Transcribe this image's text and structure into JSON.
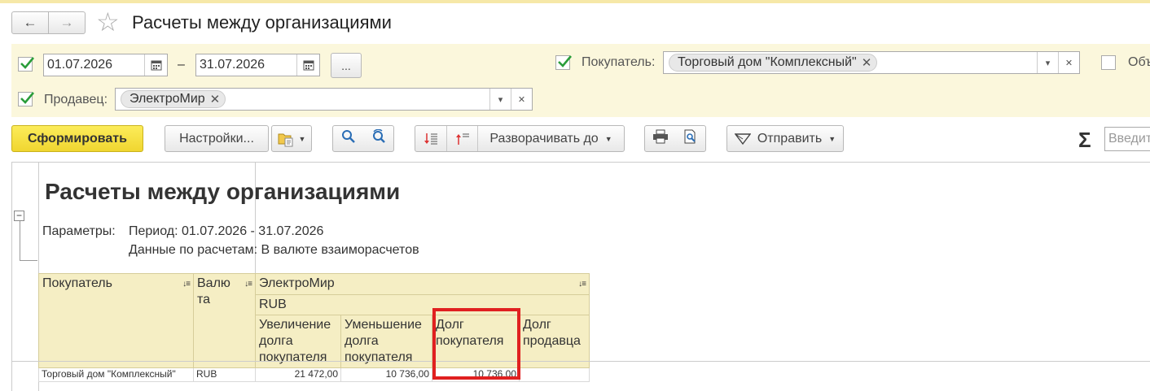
{
  "window": {
    "title": "Расчеты между организациями",
    "back_icon": "←",
    "forward_icon": "→",
    "star_icon": "☆"
  },
  "filters": {
    "period": {
      "date_from": "01.07.2026",
      "dash": "–",
      "date_to": "31.07.2026",
      "more_label": "..."
    },
    "buyer": {
      "label": "Покупатель:",
      "value": "Торговый дом \"Комплексный\""
    },
    "seller": {
      "label": "Продавец:",
      "value": "ЭлектроМир"
    },
    "extra_label": "Объ"
  },
  "toolbar": {
    "generate": "Сформировать",
    "settings": "Настройки...",
    "expand_to": "Разворачивать до",
    "send": "Отправить",
    "sum_icon": "Σ",
    "search_placeholder": "Введит"
  },
  "report": {
    "title": "Расчеты между организациями",
    "params_label": "Параметры:",
    "period_text": "Период: 01.07.2026 - 31.07.2026",
    "data_text": "Данные по расчетам: В валюте взаиморасчетов",
    "headers": {
      "buyer": "Покупатель",
      "currency": "Валю та",
      "seller": "ЭлектроМир",
      "currency_code": "RUB",
      "col_increase": "Увеличение долга покупателя",
      "col_decrease": "Уменьшение долга покупателя",
      "col_buyer_debt": "Долг покупателя",
      "col_seller_debt": "Долг продавца"
    },
    "rows": [
      {
        "buyer": "Торговый дом \"Комплексный\"",
        "currency": "RUB",
        "increase": "21 472,00",
        "decrease": "10 736,00",
        "buyer_debt": "10 736,00",
        "seller_debt": ""
      }
    ]
  },
  "colors": {
    "accent_yellow": "#f0d630",
    "filter_bg": "#fbf7dc",
    "header_bg": "#f5eec4",
    "highlight_red": "#e02020",
    "check_green": "#2a9d3a"
  }
}
